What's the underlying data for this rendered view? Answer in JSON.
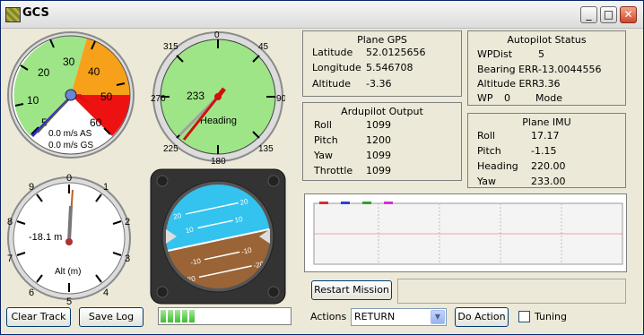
{
  "window": {
    "title": "GCS",
    "minimize_glyph": "_",
    "maximize_glyph": "□",
    "close_glyph": "✕"
  },
  "airspeed": {
    "scale": [
      "5",
      "10",
      "20",
      "30",
      "40",
      "50",
      "60"
    ],
    "as_text": "0.0 m/s AS",
    "gs_text": "0.0 m/s GS",
    "colors": {
      "green": "#9ee588",
      "orange": "#f7a11a",
      "red": "#ee1111"
    }
  },
  "compass": {
    "labels": [
      "0",
      "45",
      "90",
      "135",
      "180",
      "225",
      "270",
      "315"
    ],
    "heading_value": "233",
    "heading_label": "Heading",
    "color": "#9ee588"
  },
  "altimeter": {
    "labels": [
      "0",
      "1",
      "2",
      "3",
      "4",
      "5",
      "6",
      "7",
      "8",
      "9"
    ],
    "value_text": "-18.1 m",
    "unit_label": "Alt (m)"
  },
  "horizon": {
    "pitch_labels": [
      "20",
      "10",
      "10",
      "20",
      "-10",
      "-20",
      "-10",
      "-20"
    ],
    "colors": {
      "sky": "#33c3ee",
      "ground": "#9a6436"
    }
  },
  "plane_gps": {
    "title": "Plane GPS",
    "rows": [
      {
        "label": "Latitude",
        "value": "52.0125656"
      },
      {
        "label": "Longitude",
        "value": "5.546708"
      },
      {
        "label": "Altitude",
        "value": "-3.36"
      }
    ]
  },
  "autopilot_status": {
    "title": "Autopilot Status",
    "rows": [
      {
        "label": "WPDist",
        "value": "5"
      },
      {
        "label": "Bearing ERR",
        "value": "-13.0044556"
      },
      {
        "label": "Altitude ERR",
        "value": "3.36"
      }
    ],
    "wp_label": "WP",
    "wp_value": "0",
    "mode_label": "Mode"
  },
  "ardupilot_output": {
    "title": "Ardupilot Output",
    "rows": [
      {
        "label": "Roll",
        "value": "1099"
      },
      {
        "label": "Pitch",
        "value": "1200"
      },
      {
        "label": "Yaw",
        "value": "1099"
      },
      {
        "label": "Throttle",
        "value": "1099"
      }
    ]
  },
  "plane_imu": {
    "title": "Plane IMU",
    "rows": [
      {
        "label": "Roll",
        "value": "17.17"
      },
      {
        "label": "Pitch",
        "value": "-1.15"
      },
      {
        "label": "Heading",
        "value": "220.00"
      },
      {
        "label": "Yaw",
        "value": "233.00"
      }
    ]
  },
  "buttons": {
    "clear_track": "Clear Track",
    "save_log": "Save Log",
    "restart_mission": "Restart Mission",
    "do_action": "Do Action"
  },
  "actions": {
    "label": "Actions",
    "selected": "RETURN"
  },
  "tuning": {
    "label": "Tuning"
  },
  "progress": {
    "segments_filled": 5
  }
}
